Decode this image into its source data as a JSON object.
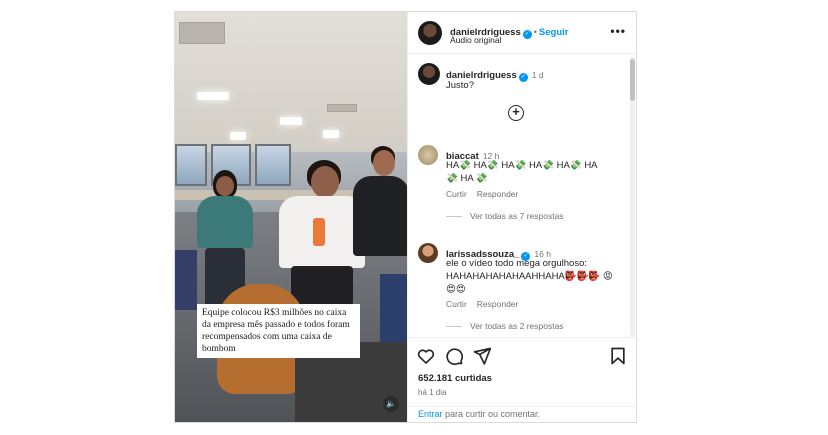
{
  "header": {
    "username": "danielrdriguess",
    "follow_label": "Seguir",
    "audio_label": "Áudio original",
    "more_label": "•••"
  },
  "caption_comment": {
    "username": "danielrdriguess",
    "time": "1 d",
    "text": "Justo?"
  },
  "comments": [
    {
      "username": "biaccat",
      "time": "12 h",
      "text": "HA💸 HA💸 HA💸 HA💸 HA💸 HA 💸 HA 💸",
      "like_label": "Curtir",
      "reply_label": "Responder",
      "replies_label": "Ver todas as 7 respostas"
    },
    {
      "username": "larissadssouza_",
      "time": "16 h",
      "text": "ele o vídeo todo mega orgulhoso: HAHAHAHAHAHAAHHAHA👺👺👺 😡😍😍",
      "like_label": "Curtir",
      "reply_label": "Responder",
      "replies_label": "Ver todas as 2 respostas"
    }
  ],
  "media": {
    "overlay_caption": "Equipe colocou R$3 milhões no caixa da empresa mês passado e todos foram recompensados com uma caixa de bombom",
    "sound_icon": "🔈"
  },
  "footer": {
    "likes": "652.181 curtidas",
    "ago": "há 1 dia",
    "login_link": "Entrar",
    "login_suffix": " para curtir ou comentar."
  },
  "colors": {
    "accent": "#0095f6",
    "border": "#dbdbdb",
    "muted": "#737373"
  }
}
